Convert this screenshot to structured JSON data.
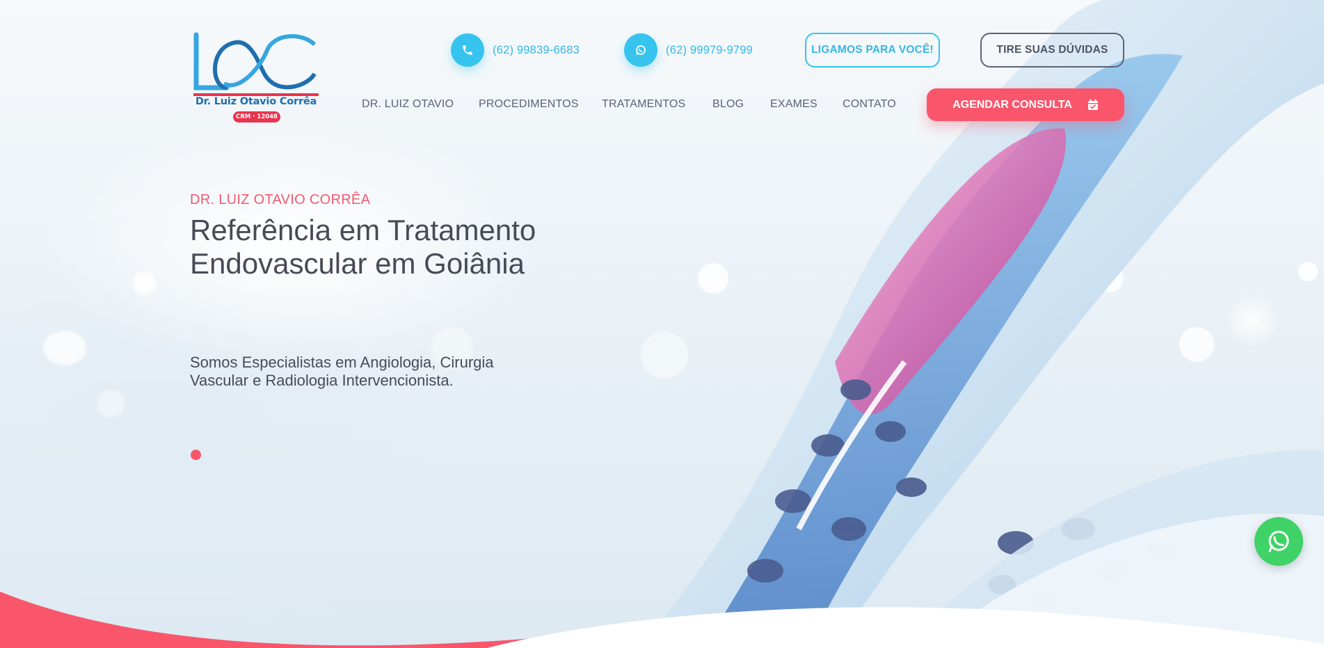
{
  "brand": {
    "logo_text": "LOC",
    "name": "Dr. Luiz Otavio Corrêa",
    "crm": "CRM · 12048"
  },
  "header": {
    "phone": {
      "number": "(62) 99839-6683",
      "icon": "phone-icon"
    },
    "whatsapp": {
      "number": "(62) 99979-9799",
      "icon": "whatsapp-icon"
    },
    "callback_button": "LIGAMOS PARA VOCÊ!",
    "questions_button": "TIRE SUAS DÚVIDAS",
    "cta_button": {
      "label": "AGENDAR CONSULTA",
      "icon": "calendar-check-icon"
    }
  },
  "nav": {
    "items": [
      {
        "label": "DR. LUIZ OTAVIO"
      },
      {
        "label": "PROCEDIMENTOS"
      },
      {
        "label": "TRATAMENTOS"
      },
      {
        "label": "BLOG"
      },
      {
        "label": "EXAMES"
      },
      {
        "label": "CONTATO"
      }
    ]
  },
  "hero": {
    "kicker": "DR. LUIZ OTAVIO CORRÊA",
    "headline": "Referência em Tratamento Endovascular em Goiânia",
    "subtitle": "Somos Especialistas em Angiologia, Cirurgia Vascular e Radiologia Intervencionista.",
    "slide_count": 1,
    "active_slide": 1
  },
  "floating": {
    "whatsapp_icon": "whatsapp-icon"
  },
  "colors": {
    "accent_blue": "#36c3ee",
    "accent_pink": "#f9566c",
    "text_dark": "#474b56",
    "logo_blue": "#1f6fae",
    "whatsapp_green": "#3fd267"
  }
}
